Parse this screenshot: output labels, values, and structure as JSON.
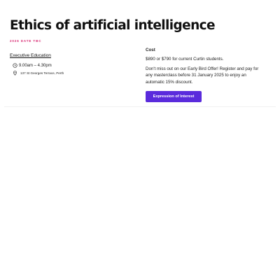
{
  "course": {
    "title": "Ethics of artificial intelligence",
    "date_tag": "2026 DATE TBC"
  },
  "details": {
    "category_link": "Executive Education",
    "time": "9.00am – 4.30pm",
    "time_icon": "clock-icon",
    "location": "137 St Georges Terrace, Perth",
    "location_icon": "map-pin-icon"
  },
  "pricing": {
    "label": "Cost",
    "cost_text": "$890 or $790 for current Curtin students.",
    "promo_text": "Don't miss out on our Early Bird Offer! Register and pay for any masterclass before 31 January 2025 to enjoy an automatic 15% discount.",
    "cta_label": "Expression of Interest"
  },
  "colors": {
    "accent": "#5a2bdc",
    "date_tag": "#d6246e",
    "text": "#1a1a1a"
  }
}
